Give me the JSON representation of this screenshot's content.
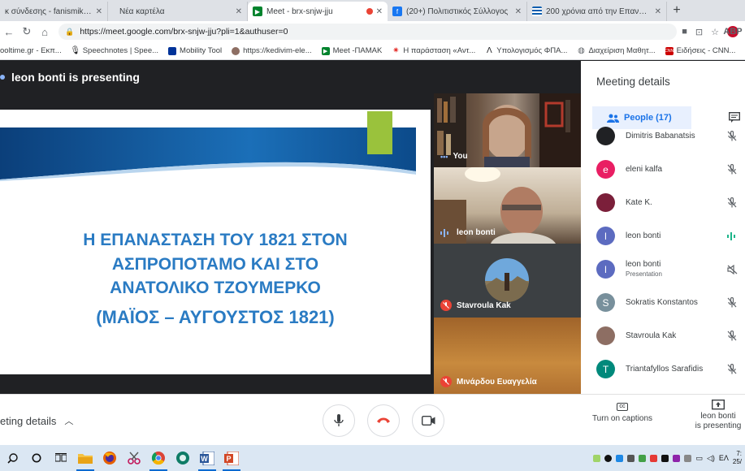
{
  "browser": {
    "tabs": [
      {
        "title": "κ σύνδεσης - fanismikiotti@...",
        "active": false,
        "favicon_color": "#1a73e8",
        "favicon": "mail-icon"
      },
      {
        "title": "Νέα καρτέλα",
        "active": false,
        "favicon_color": "#9aa0a6",
        "favicon": "blank-icon"
      },
      {
        "title": "Meet - brx-snjw-jju",
        "active": true,
        "favicon_color": "#00832d",
        "favicon": "meet-icon"
      },
      {
        "title": "(20+) Πολιτιστικός Σύλλογος",
        "active": false,
        "favicon_color": "#1877f2",
        "favicon": "facebook-icon"
      },
      {
        "title": "200 χρόνια από την Επανάστ",
        "active": false,
        "favicon_color": "#0d5eaf",
        "favicon": "greek-flag-icon"
      }
    ],
    "new_tab": "+",
    "url": "https://meet.google.com/brx-snjw-jju?pli=1&authuser=0",
    "bookmarks": [
      {
        "label": "ooltime.gr - Εκπ...",
        "color": "#e8710a"
      },
      {
        "label": "Speechnotes | Spee...",
        "color": "#202124"
      },
      {
        "label": "Mobility Tool",
        "color": "#003399"
      },
      {
        "label": "https://kedivim-ele...",
        "color": "#5f6368"
      },
      {
        "label": "Meet -ΠΑΜΑΚ",
        "color": "#00832d"
      },
      {
        "label": "Η παράσταση «Αντ...",
        "color": "#e53935"
      },
      {
        "label": "Υπολογισμός ΦΠΑ...",
        "color": "#202124"
      },
      {
        "label": "Διαχείριση Μαθητ...",
        "color": "#5f6368"
      },
      {
        "label": "Ειδήσεις - CNN...",
        "color": "#cc0000"
      }
    ]
  },
  "meet": {
    "presenting_banner": "leon bonti is presenting",
    "slide": {
      "title_lines": [
        "Η ΕΠΑΝΑΣΤΑΣΗ ΤΟΥ 1821 ΣΤΟΝ",
        "ΑΣΠΡΟΠΟΤΑΜΟ ΚΑΙ ΣΤΟ",
        "ΑΝΑΤΟΛΙΚΟ ΤΖΟΥΜΕΡΚΟ"
      ],
      "subtitle": "(ΜΑΪΟΣ – ΑΥΓΟΥΣΤΟΣ 1821)"
    },
    "tiles": [
      {
        "name": "You",
        "status": "speaking-dots"
      },
      {
        "name": "leon bonti",
        "status": "speaking"
      },
      {
        "name": "Stavroula Kak",
        "status": "muted"
      },
      {
        "name": "Μινάρδου Ευαγγελία",
        "status": "muted"
      }
    ],
    "panel": {
      "title": "Meeting details",
      "people_tab": "People (17)",
      "people": [
        {
          "name": "Dimitris Babanatsis",
          "sub": "",
          "initial": "",
          "avatar_color": "#202124",
          "mic": "muted"
        },
        {
          "name": "eleni kalfa",
          "sub": "",
          "initial": "e",
          "avatar_color": "#e91e63",
          "mic": "muted"
        },
        {
          "name": "Kate K.",
          "sub": "",
          "initial": "",
          "avatar_color": "#7b1f3a",
          "mic": "muted"
        },
        {
          "name": "leon bonti",
          "sub": "",
          "initial": "l",
          "avatar_color": "#5c6bc0",
          "mic": "speaking"
        },
        {
          "name": "leon bonti",
          "sub": "Presentation",
          "initial": "l",
          "avatar_color": "#5c6bc0",
          "mic": "no-audio"
        },
        {
          "name": "Sokratis Konstantos",
          "sub": "",
          "initial": "S",
          "avatar_color": "#78909c",
          "mic": "muted"
        },
        {
          "name": "Stavroula Kak",
          "sub": "",
          "initial": "",
          "avatar_color": "#8d6e63",
          "mic": "muted"
        },
        {
          "name": "Triantafyllos Sarafidis",
          "sub": "",
          "initial": "T",
          "avatar_color": "#00897b",
          "mic": "muted"
        }
      ]
    },
    "bottom": {
      "meeting_details": "eting details",
      "captions": "Turn on captions",
      "presenting_line1": "leon bonti",
      "presenting_line2": "is presenting",
      "cc": "CC"
    }
  },
  "taskbar": {
    "search_icon": "search-icon",
    "language": "ΕΛ",
    "time": "7:",
    "date": "25/"
  }
}
